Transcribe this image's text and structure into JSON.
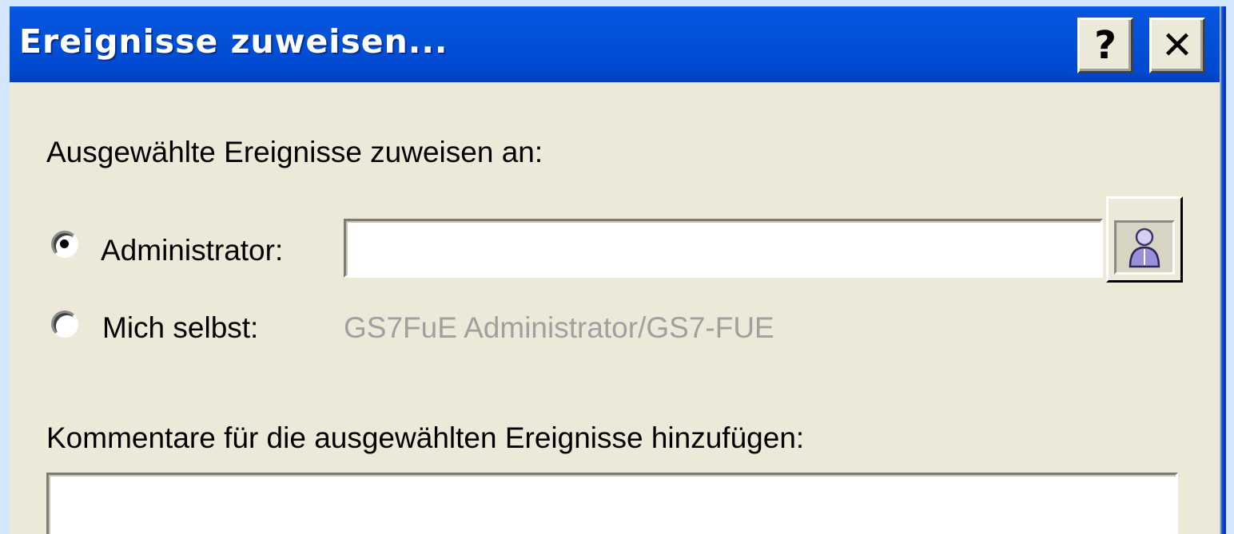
{
  "dialog": {
    "title": "Ereignisse zuweisen...",
    "help_glyph": "?",
    "close_glyph": "✕"
  },
  "assign": {
    "heading": "Ausgewählte Ereignisse zuweisen an:",
    "options": [
      {
        "label": "Administrator:",
        "selected": true,
        "input_value": ""
      },
      {
        "label": "Mich selbst:",
        "selected": false,
        "value": "GS7FuE Administrator/GS7-FUE"
      }
    ],
    "select_user_icon": "user-icon"
  },
  "comments": {
    "heading": "Kommentare für die ausgewählten Ereignisse hinzufügen:",
    "value": ""
  },
  "colors": {
    "titlebar": "#0352d7",
    "dialog_bg": "#ece9d8",
    "disabled_text": "#a0a0a0"
  }
}
